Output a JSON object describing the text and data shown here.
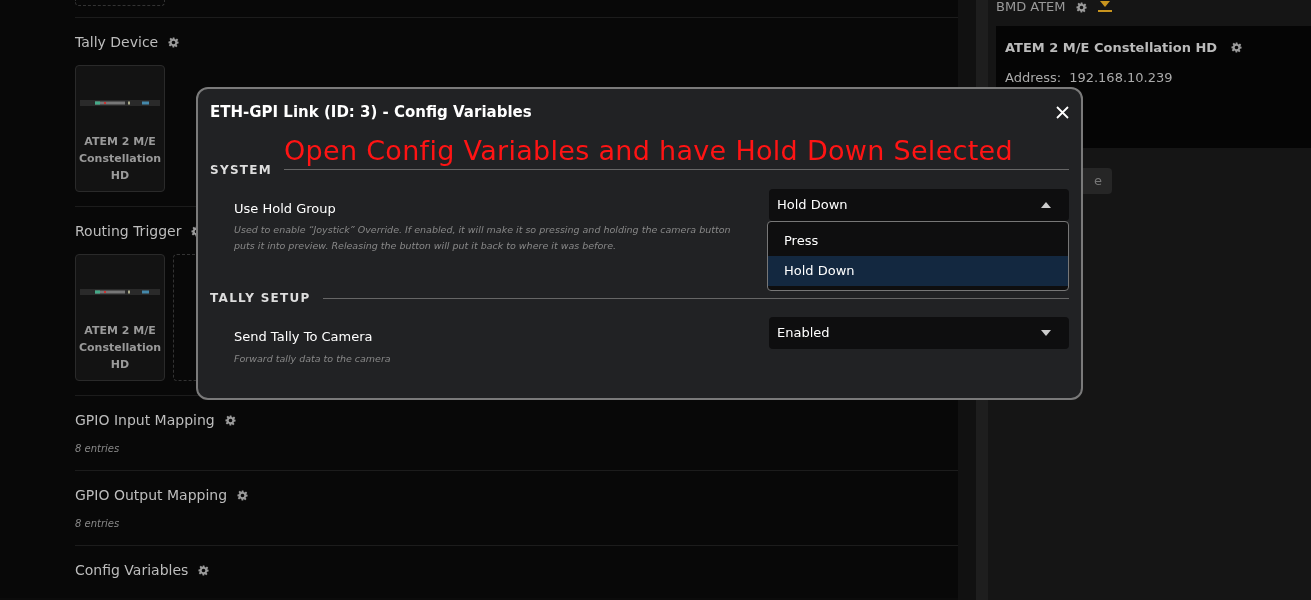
{
  "main": {
    "sections": [
      {
        "kind": "devices",
        "title": "Tally Device",
        "devices": [
          {
            "name": "ATEM 2 M/E Constellation HD"
          }
        ],
        "empty_slot": false
      },
      {
        "kind": "devices",
        "title": "Routing Trigger",
        "devices": [
          {
            "name": "ATEM 2 M/E Constellation HD"
          }
        ],
        "empty_slot": true
      },
      {
        "kind": "entries",
        "title": "GPIO Input Mapping",
        "note": "8 entries"
      },
      {
        "kind": "entries",
        "title": "GPIO Output Mapping",
        "note": "8 entries"
      },
      {
        "kind": "plain",
        "title": "Config Variables"
      }
    ]
  },
  "side_panel": {
    "header": "BMD ATEM",
    "card": {
      "title": "ATEM 2 M/E Constellation HD",
      "address_label": "Address:",
      "address": "192.168.10.239"
    },
    "button_label": "e"
  },
  "modal": {
    "title": "ETH-GPI Link (ID: 3) - Config Variables",
    "annotation": "Open Config Variables and have Hold Down Selected",
    "groups": [
      {
        "heading": "SYSTEM",
        "settings": [
          {
            "label": "Use Hold Group",
            "description": "Used to enable “Joystick” Override. If enabled, it will make it so pressing and holding the camera button puts it into preview. Releasing the button will put it back to where it was before.",
            "value": "Hold Down",
            "expanded": true,
            "options": [
              {
                "label": "Press",
                "selected": false
              },
              {
                "label": "Hold Down",
                "selected": true
              }
            ]
          }
        ]
      },
      {
        "heading": "TALLY SETUP",
        "settings": [
          {
            "label": "Send Tally To Camera",
            "description": "Forward tally data to the camera",
            "value": "Enabled",
            "expanded": false
          }
        ]
      }
    ]
  }
}
